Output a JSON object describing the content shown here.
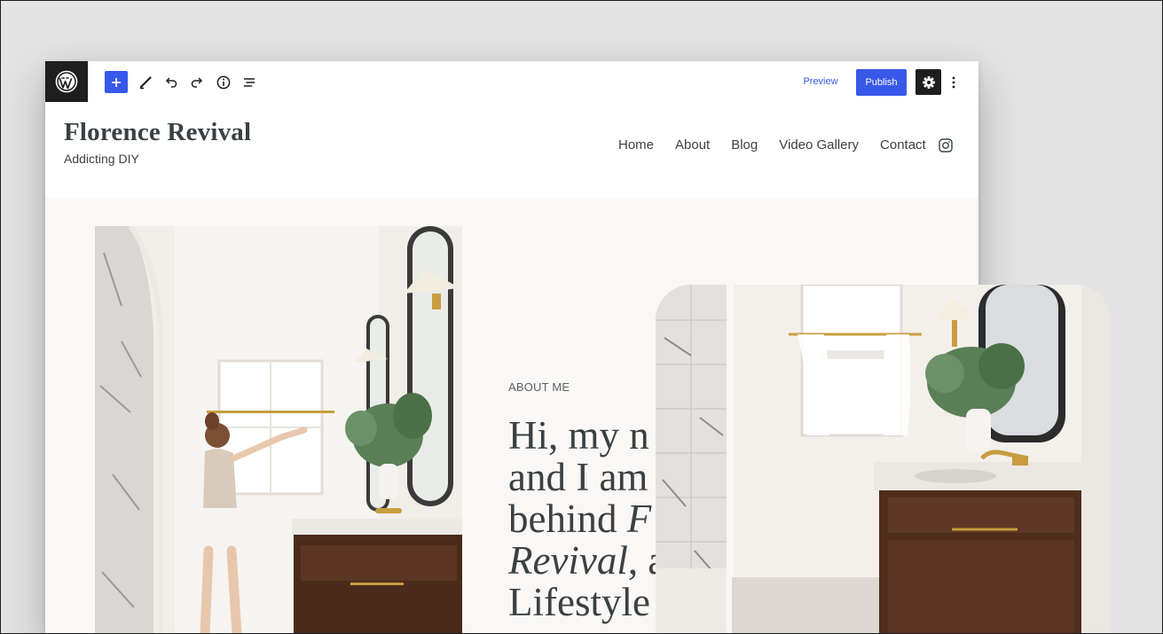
{
  "toolbar": {
    "preview_label": "Preview",
    "publish_label": "Publish",
    "icons": [
      "wordpress-logo-icon",
      "plus-icon",
      "pencil-icon",
      "undo-icon",
      "redo-icon",
      "info-icon",
      "list-view-icon",
      "gear-icon",
      "more-vertical-icon"
    ]
  },
  "site": {
    "title": "Florence Revival",
    "tagline": "Addicting DIY",
    "nav": [
      "Home",
      "About",
      "Blog",
      "Video Gallery",
      "Contact"
    ],
    "social_icon": "instagram-icon"
  },
  "content": {
    "eyebrow": "ABOUT ME",
    "heading_lines": [
      "Hi, my n",
      "and I am",
      "behind",
      "Revival, a",
      "Lifestyle"
    ],
    "heading_italic": [
      "F",
      "Revival"
    ]
  },
  "colors": {
    "accent": "#3858e9",
    "dark": "#1e1e1e",
    "text": "#3b4043",
    "content_bg": "#faf8f6"
  }
}
